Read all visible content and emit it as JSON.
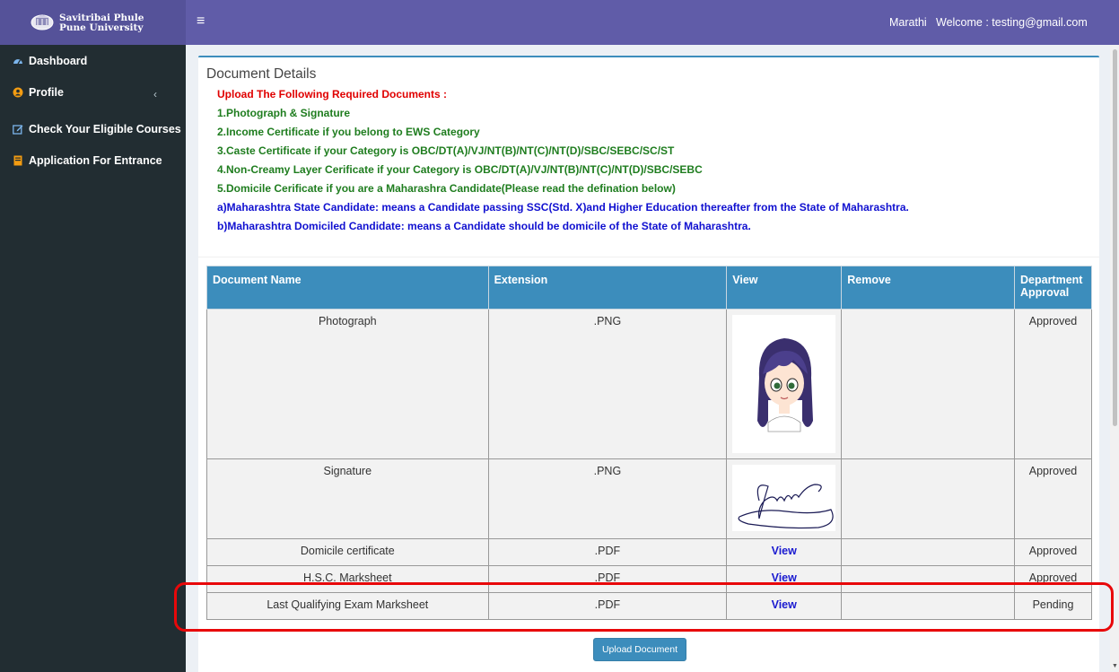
{
  "header": {
    "logo_line1": "Savitribai Phule",
    "logo_line2": "Pune University",
    "menu_toggle": "≡",
    "language": "Marathi",
    "welcome": "Welcome : testing@gmail.com"
  },
  "sidebar": {
    "items": [
      {
        "label": "Dashboard",
        "icon": "dashboard-icon"
      },
      {
        "label": "Profile",
        "icon": "user-circle-icon"
      },
      {
        "label": "Check Your Eligible Courses",
        "icon": "edit-icon"
      },
      {
        "label": "Application For Entrance",
        "icon": "book-icon"
      }
    ],
    "profile_chevron": "‹"
  },
  "box": {
    "title": "Document Details",
    "instructions": [
      {
        "text": "Upload The Following Required Documents :",
        "color": "red"
      },
      {
        "text": "1.Photograph & Signature",
        "color": "green"
      },
      {
        "text": "2.Income Certificate if you belong to EWS Category",
        "color": "green"
      },
      {
        "text": "3.Caste Certificate if your Category is OBC/DT(A)/VJ/NT(B)/NT(C)/NT(D)/SBC/SEBC/SC/ST",
        "color": "green"
      },
      {
        "text": "4.Non-Creamy Layer Cerificate if your Category is OBC/DT(A)/VJ/NT(B)/NT(C)/NT(D)/SBC/SEBC",
        "color": "green"
      },
      {
        "text": "5.Domicile Cerificate if you are a Maharashra Candidate(Please read the defination below)",
        "color": "green"
      },
      {
        "text": "a)Maharashtra State Candidate: means a Candidate passing SSC(Std. X)and Higher Education thereafter from the State of Maharashtra.",
        "color": "blue"
      },
      {
        "text": "b)Maharashtra Domiciled Candidate: means a Candidate should be domicile of the State of Maharashtra.",
        "color": "blue"
      }
    ]
  },
  "table": {
    "headers": [
      "Document Name",
      "Extension",
      "View",
      "Remove",
      "Department Approval"
    ],
    "rows": [
      {
        "name": "Photograph",
        "ext": ".PNG",
        "view": "",
        "status": "Approved"
      },
      {
        "name": "Signature",
        "ext": ".PNG",
        "view": "",
        "status": "Approved"
      },
      {
        "name": "Domicile certificate",
        "ext": ".PDF",
        "view": "View",
        "status": "Approved"
      },
      {
        "name": "H.S.C. Marksheet",
        "ext": ".PDF",
        "view": "View",
        "status": "Approved"
      },
      {
        "name": "Last Qualifying Exam Marksheet",
        "ext": ".PDF",
        "view": "View",
        "status": "Pending"
      }
    ]
  },
  "upload_button": "Upload Document",
  "colors": {
    "header": "#605ca8",
    "sidebar": "#222d32",
    "table_header": "#3c8dbc",
    "status": "#f05a28",
    "highlight": "#e8080a"
  }
}
